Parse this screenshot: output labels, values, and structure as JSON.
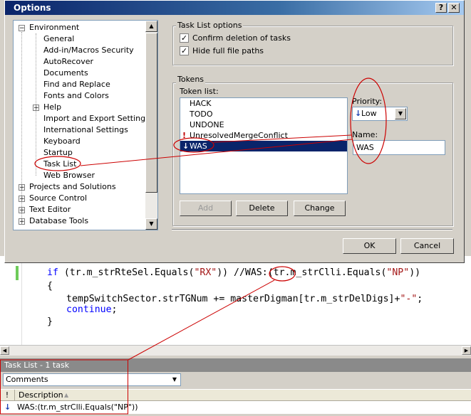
{
  "dialog": {
    "title": "Options",
    "help_label": "?",
    "close_label": "✕"
  },
  "tree": {
    "items": [
      {
        "label": "Environment",
        "expander": "−"
      },
      {
        "label": "General"
      },
      {
        "label": "Add-in/Macros Security"
      },
      {
        "label": "AutoRecover"
      },
      {
        "label": "Documents"
      },
      {
        "label": "Find and Replace"
      },
      {
        "label": "Fonts and Colors"
      },
      {
        "label": "Help",
        "expander": "+"
      },
      {
        "label": "Import and Export Settings"
      },
      {
        "label": "International Settings"
      },
      {
        "label": "Keyboard"
      },
      {
        "label": "Startup"
      },
      {
        "label": "Task List"
      },
      {
        "label": "Web Browser"
      },
      {
        "label": "Projects and Solutions",
        "expander": "+"
      },
      {
        "label": "Source Control",
        "expander": "+"
      },
      {
        "label": "Text Editor",
        "expander": "+"
      },
      {
        "label": "Database Tools",
        "expander": "+"
      }
    ]
  },
  "task_list_options": {
    "group_label": "Task List options",
    "confirm_delete": {
      "label": "Confirm deletion of tasks",
      "checked": true
    },
    "hide_paths": {
      "label": "Hide full file paths",
      "checked": true
    }
  },
  "tokens": {
    "group_label": "Tokens",
    "list_label": "Token list:",
    "items": [
      {
        "label": "HACK",
        "icon": ""
      },
      {
        "label": "TODO",
        "icon": ""
      },
      {
        "label": "UNDONE",
        "icon": ""
      },
      {
        "label": "UnresolvedMergeConflict",
        "icon": "!"
      },
      {
        "label": "WAS",
        "icon": "↓"
      }
    ],
    "priority_label": "Priority:",
    "priority_value": "Low",
    "priority_arrow": "↓",
    "name_label": "Name:",
    "name_value": "WAS",
    "add_label": "Add",
    "delete_label": "Delete",
    "change_label": "Change"
  },
  "footer": {
    "ok_label": "OK",
    "cancel_label": "Cancel"
  },
  "editor": {
    "line1": {
      "kw": "if",
      "a": " (tr.m_strRteSel.Equals(",
      "s1": "\"RX\"",
      "b": ")) //",
      "was": "WAS",
      "c": ":(tr.m_strClli.Equals(",
      "s2": "\"NP\"",
      "d": "))"
    },
    "line2": "{",
    "line3": {
      "a": "tempSwitchSector.strTGNum += masterDigman[tr.m_strDelDigs]+",
      "s": "\"-\"",
      "b": ";"
    },
    "line4": {
      "kw": "continue",
      "b": ";"
    },
    "line5": "}"
  },
  "task_panel": {
    "header": "Task List - 1 task",
    "filter": "Comments",
    "col_priority": "!",
    "col_description": "Description",
    "row": {
      "priority_icon": "↓",
      "description": "WAS:(tr.m_strClli.Equals(\"NP\"))"
    }
  },
  "colors": {
    "annotation": "#cc0000",
    "title_bar": "#0a246a",
    "selection": "#0a246a"
  }
}
